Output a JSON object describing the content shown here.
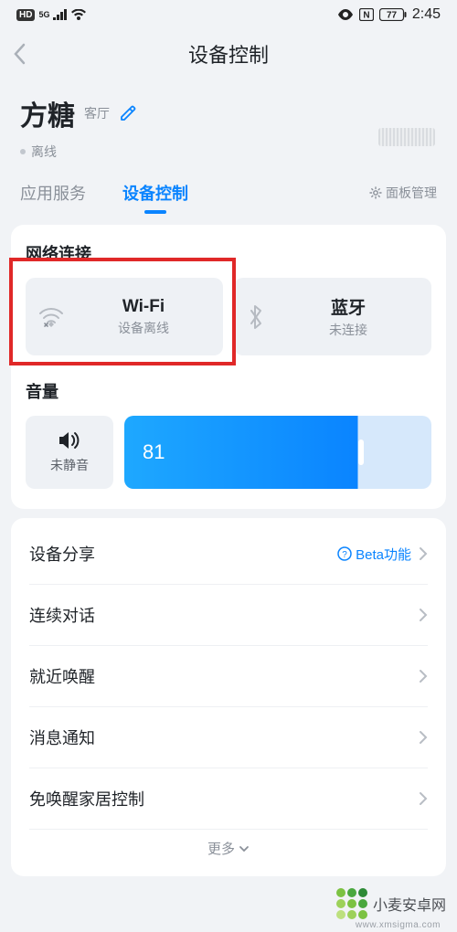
{
  "status_bar": {
    "hd": "HD",
    "net": "5G",
    "nfc": "N",
    "battery": "77",
    "time": "2:45"
  },
  "header": {
    "title": "设备控制"
  },
  "device": {
    "name": "方糖",
    "room": "客厅",
    "status": "离线"
  },
  "tabs": {
    "app_service": "应用服务",
    "device_control": "设备控制",
    "panel_mgmt": "面板管理"
  },
  "network": {
    "section": "网络连接",
    "wifi": {
      "label": "Wi-Fi",
      "sub": "设备离线"
    },
    "bt": {
      "label": "蓝牙",
      "sub": "未连接"
    }
  },
  "volume": {
    "section": "音量",
    "mute_label": "未静音",
    "value": "81"
  },
  "settings": {
    "share": "设备分享",
    "beta": "Beta功能",
    "continuous": "连续对话",
    "nearby": "就近唤醒",
    "notify": "消息通知",
    "no_wake": "免唤醒家居控制",
    "more": "更多"
  },
  "watermark": {
    "brand": "小麦安卓网",
    "url": "www.xmsigma.com"
  }
}
